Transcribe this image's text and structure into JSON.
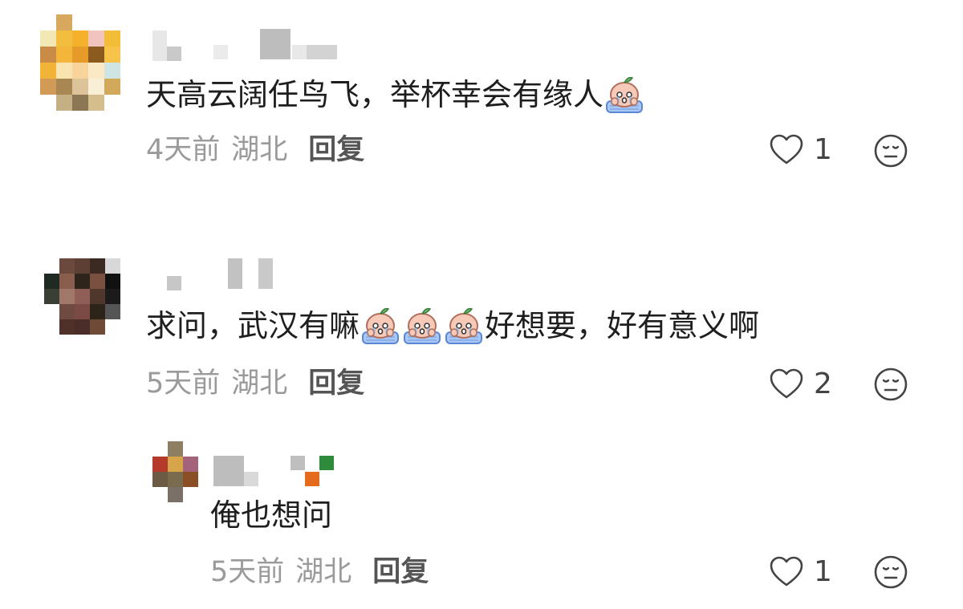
{
  "comments": [
    {
      "text_before": "天高云阔任鸟飞，举杯幸会有缘人",
      "text_after": "",
      "sticker_icon": "crying-peach-emoji",
      "time": "4天前",
      "location": "湖北",
      "reply_label": "回复",
      "likes": "1"
    },
    {
      "text_before": "求问，武汉有嘛",
      "text_after": "好想要，好有意义啊",
      "sticker_icon": "crying-peach-emoji",
      "time": "5天前",
      "location": "湖北",
      "reply_label": "回复",
      "likes": "2"
    }
  ],
  "replies": [
    {
      "text": "俺也想问",
      "time": "5天前",
      "location": "湖北",
      "reply_label": "回复",
      "likes": "1"
    }
  ],
  "icons": {
    "like": "heart-outline-icon",
    "reaction": "neutral-face-icon"
  },
  "colors": {
    "text": "#1e1e1e",
    "meta": "#9a9a9a",
    "reply": "#555555",
    "icon": "#444444"
  }
}
